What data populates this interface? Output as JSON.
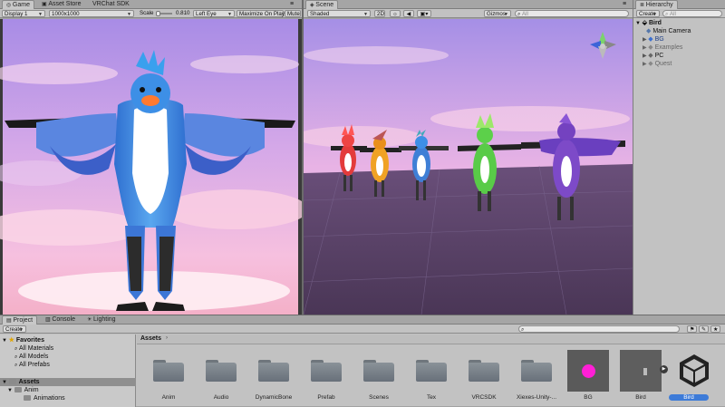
{
  "game_panel": {
    "tabs": [
      "Game",
      "Asset Store",
      "VRChat SDK"
    ],
    "display": "Display 1",
    "resolution": "1000x1000",
    "scale_label": "Scale",
    "scale_value": "0.810",
    "eye": "Left Eye",
    "maximize": "Maximize On Play",
    "mute": "Mute"
  },
  "scene_panel": {
    "tab": "Scene",
    "shading": "Shaded",
    "mode_2d": "2D",
    "gizmos": "Gizmos",
    "search_placeholder": "All"
  },
  "hierarchy": {
    "tab": "Hierarchy",
    "create": "Create",
    "search_placeholder": "All",
    "scene_name": "Bird",
    "items": [
      "Main Camera",
      "BG",
      "Examples",
      "PC",
      "Quest"
    ]
  },
  "project": {
    "tabs": [
      "Project",
      "Console",
      "Lighting"
    ],
    "create": "Create",
    "favorites_label": "Favorites",
    "favorites": [
      "All Materials",
      "All Models",
      "All Prefabs"
    ],
    "assets_label": "Assets",
    "tree": [
      "Anim",
      "Animations"
    ],
    "breadcrumb": "Assets",
    "asset_labels": [
      "Anim",
      "Audio",
      "DynamicBone",
      "Prefab",
      "Scenes",
      "Tex",
      "VRCSDK",
      "Xiexes-Unity-...",
      "BG",
      "Bird",
      "Bird"
    ]
  },
  "colors": {
    "selection": "#3d7bd8",
    "panel": "#c2c2c2",
    "sky_top": "#a98be5",
    "sky_bottom": "#f7b9de"
  }
}
